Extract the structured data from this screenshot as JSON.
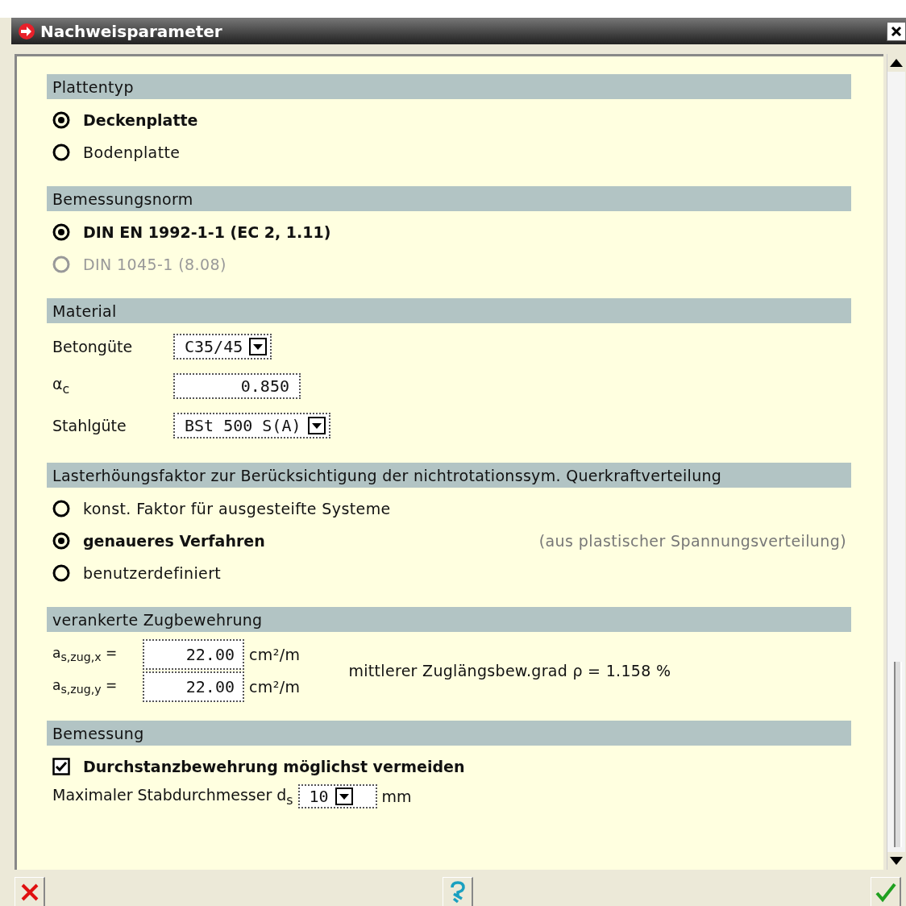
{
  "window": {
    "title": "Nachweisparameter"
  },
  "sections": [
    {
      "title": "Plattentyp",
      "kind": "radios",
      "options": [
        {
          "label": "Deckenplatte",
          "selected": true,
          "disabled": false
        },
        {
          "label": "Bodenplatte",
          "selected": false,
          "disabled": false
        }
      ]
    },
    {
      "title": "Bemessungsnorm",
      "kind": "radios",
      "options": [
        {
          "label": "DIN EN 1992-1-1 (EC 2, 1.11)",
          "selected": true,
          "disabled": false
        },
        {
          "label": "DIN 1045-1 (8.08)",
          "selected": false,
          "disabled": true
        }
      ]
    },
    {
      "title": "Material",
      "kind": "fields",
      "rows": [
        {
          "label": "Betongüte",
          "value": "C35/45",
          "kind": "dropdown"
        },
        {
          "label": "α$_{c}$",
          "value": "0.850",
          "kind": "input"
        },
        {
          "label": "Stahlgüte",
          "value": "BSt 500 S(A)",
          "kind": "dropdown"
        }
      ]
    },
    {
      "title": "Lasterhöungsfaktor zur Berücksichtigung der nichtrotationssym. Querkraftverteilung",
      "kind": "radios",
      "options": [
        {
          "label": "konst. Faktor für ausgesteifte Systeme",
          "selected": false,
          "disabled": false
        },
        {
          "label": "genaueres Verfahren",
          "selected": true,
          "disabled": false,
          "note": "(aus plastischer Spannungsverteilung)"
        },
        {
          "label": "benutzerdefiniert",
          "selected": false,
          "disabled": false
        }
      ]
    },
    {
      "title": "verankerte Zugbewehrung",
      "kind": "reinforcement",
      "rows": [
        {
          "label": "a$_{s,zug,x}$ =",
          "value": "22.00",
          "unit": "cm²/m"
        },
        {
          "label": "a$_{s,zug,y}$ =",
          "value": "22.00",
          "unit": "cm²/m"
        }
      ],
      "note": "mittlerer Zuglängsbew.grad ρ = 1.158 %"
    },
    {
      "title": "Bemessung",
      "kind": "design",
      "checkbox": {
        "label": "Durchstanzbewehrung möglichst vermeiden",
        "checked": true
      },
      "field": {
        "label": "Maximaler Stabdurchmesser d$_{s}$",
        "value": "10",
        "unit": "mm"
      }
    }
  ]
}
